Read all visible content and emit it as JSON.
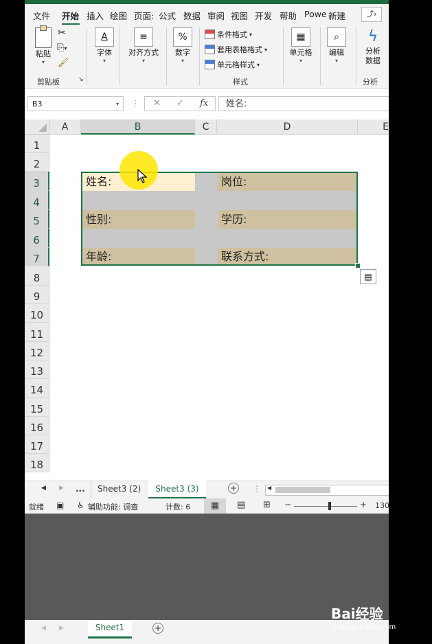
{
  "ribbon_tabs": [
    "文件",
    "开始",
    "插入",
    "绘图",
    "页面:",
    "公式",
    "数据",
    "审阅",
    "视图",
    "开发",
    "帮助",
    "Powe",
    "新建"
  ],
  "ribbon": {
    "paste": "粘贴",
    "clipboard_group": "剪贴板",
    "font": "字体",
    "align": "对齐方式",
    "number": "数字",
    "number_symbol": "%",
    "font_symbol": "A",
    "cond_format": "条件格式",
    "table_format": "套用表格格式",
    "cell_style": "单元格样式",
    "styles_group": "样式",
    "cells": "单元格",
    "edit": "编辑",
    "analyze_line1": "分析",
    "analyze_line2": "数据",
    "analysis_group": "分析"
  },
  "formula_bar": {
    "name_box": "B3",
    "fx": "fx",
    "value": "姓名:"
  },
  "columns": [
    "A",
    "B",
    "C",
    "D",
    "E"
  ],
  "rows": [
    "1",
    "2",
    "3",
    "4",
    "5",
    "6",
    "7",
    "8",
    "9",
    "10",
    "11",
    "12",
    "13",
    "14",
    "15",
    "16",
    "17",
    "18"
  ],
  "cells": {
    "b3": "姓名:",
    "d3": "岗位:",
    "b5": "性别:",
    "d5": "学历:",
    "b7": "年龄:",
    "d7": "联系方式:"
  },
  "sheet_tabs": {
    "ellipsis": "...",
    "tab1": "Sheet3 (2)",
    "tab2": "Sheet3 (3)"
  },
  "status": {
    "ready": "就绪",
    "accessibility": "辅助功能: 调查",
    "count": "计数: 6",
    "zoom": "130"
  },
  "bottom": {
    "sheet": "Sheet1"
  },
  "watermark": {
    "brand": "Bai经验",
    "url": "jingyan.baidu.com"
  },
  "colors": {
    "accent": "#217346",
    "fill": "#cfc1a0",
    "gray": "#c8c8c8",
    "active": "#fdefd0"
  }
}
